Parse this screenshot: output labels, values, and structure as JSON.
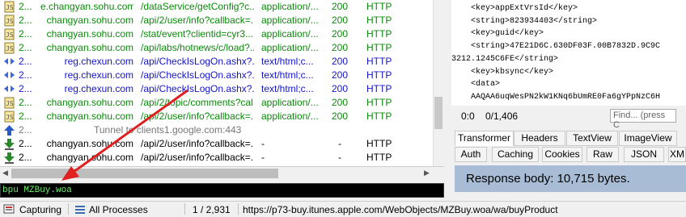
{
  "sessions": [
    {
      "num": "2...",
      "host": "e.changyan.sohu.com",
      "url": "/dataService/getConfig?c...",
      "ct": "application/...",
      "result": "200",
      "protocol": "HTTP",
      "color": "green",
      "icon": "script-icon"
    },
    {
      "num": "2...",
      "host": "changyan.sohu.com",
      "url": "/api/2/user/info?callback=...",
      "ct": "application/...",
      "result": "200",
      "protocol": "HTTP",
      "color": "green",
      "icon": "script-icon"
    },
    {
      "num": "2...",
      "host": "changyan.sohu.com",
      "url": "/stat/event?clientid=cyr3...",
      "ct": "application/...",
      "result": "200",
      "protocol": "HTTP",
      "color": "green",
      "icon": "script-icon"
    },
    {
      "num": "2...",
      "host": "changyan.sohu.com",
      "url": "/api/labs/hotnews/c/load?...",
      "ct": "application/...",
      "result": "200",
      "protocol": "HTTP",
      "color": "green",
      "icon": "script-icon"
    },
    {
      "num": "2...",
      "host": "reg.chexun.com",
      "url": "/api/CheckIsLogOn.ashx?...",
      "ct": "text/html;c...",
      "result": "200",
      "protocol": "HTTP",
      "color": "blue",
      "icon": "html-icon"
    },
    {
      "num": "2...",
      "host": "reg.chexun.com",
      "url": "/api/CheckIsLogOn.ashx?...",
      "ct": "text/html;c...",
      "result": "200",
      "protocol": "HTTP",
      "color": "blue",
      "icon": "html-icon"
    },
    {
      "num": "2...",
      "host": "reg.chexun.com",
      "url": "/api/CheckIsLogOn.ashx?...",
      "ct": "text/html;c...",
      "result": "200",
      "protocol": "HTTP",
      "color": "blue",
      "icon": "html-icon"
    },
    {
      "num": "2...",
      "host": "changyan.sohu.com",
      "url": "/api/2/topic/comments?cal...",
      "ct": "application/...",
      "result": "200",
      "protocol": "HTTP",
      "color": "green",
      "icon": "script-icon"
    },
    {
      "num": "2...",
      "host": "changyan.sohu.com",
      "url": "/api/2/user/info?callback=...",
      "ct": "application/...",
      "result": "200",
      "protocol": "HTTP",
      "color": "green",
      "icon": "script-icon"
    },
    {
      "num": "2...",
      "host": "",
      "url": "",
      "ct": "",
      "result": "",
      "protocol": "",
      "color": "grey",
      "icon": "tunnel-up-icon",
      "tunnel": "Tunnel to clients1.google.com:443"
    },
    {
      "num": "2...",
      "host": "changyan.sohu.com",
      "url": "/api/2/user/info?callback=...",
      "ct": "-",
      "result": "-",
      "protocol": "HTTP",
      "color": "black",
      "icon": "download-arrow-icon"
    },
    {
      "num": "2...",
      "host": "changyan.sohu.com",
      "url": "/api/2/user/info?callback=...",
      "ct": "-",
      "result": "-",
      "protocol": "HTTP",
      "color": "black",
      "icon": "download-arrow-icon"
    }
  ],
  "quickexec": {
    "value": "bpu MZBuy.woa"
  },
  "xml_lines": [
    "    <key>appExtVrsId</key>",
    "    <string>823934403</string>",
    "    <key>guid</key>",
    "    <string>47E21D6C.630DF03F.00B7832D.9C9C",
    "3212.1245C6FE</string>",
    "    <key>kbsync</key>",
    "    <data>",
    "    AAQAA6uqWesPN2kW1KNq6bUmRE0Fa6gYPpNzC6H"
  ],
  "xml_footer": {
    "pos1": "0:0",
    "pos2": "0/1,406",
    "find_placeholder": "Find... (press C"
  },
  "tabs_row1": [
    "Transformer",
    "Headers",
    "TextView",
    "ImageView"
  ],
  "tabs_row2": [
    "Auth",
    "Caching",
    "Cookies",
    "Raw",
    "JSON",
    "XM"
  ],
  "response_body": "Response body: 10,715 bytes.",
  "status": {
    "capture": "Capturing",
    "processes": "All Processes",
    "count": "1 / 2,931",
    "url": "https://p73-buy.itunes.apple.com/WebObjects/MZBuy.woa/wa/buyProduct"
  },
  "colors": {
    "green": "#0a8a0a",
    "blue": "#1414c8",
    "arrow": "#e02020",
    "response_bar": "#a9bcd6"
  }
}
